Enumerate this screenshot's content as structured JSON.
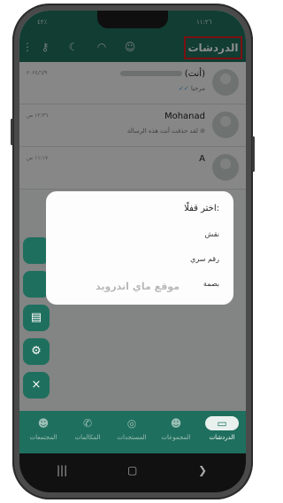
{
  "status_bar": {
    "time": "١١:٢٦",
    "left_status": "٤٢٪"
  },
  "app_bar": {
    "title": "الدردشات"
  },
  "chats": [
    {
      "name": "(أنت)",
      "preview": "مرحبا",
      "date": "٢٠٢٤/٦/٩"
    },
    {
      "name": "Mohanad",
      "preview": "لقد حذفت أنت هذه الرسالة",
      "date": "١٢:٣٦ ص"
    },
    {
      "name": "A",
      "preview": "",
      "date": "١١:١٧ ص"
    }
  ],
  "dialog": {
    "title": "اختر قفلًا:",
    "options": [
      "نقش",
      "رقم سري",
      "بصمة"
    ],
    "watermark": "موقع ماي اندرويد"
  },
  "bottom_nav": {
    "items": [
      {
        "label": "الدردشات",
        "icon": "chat-bubbles-icon"
      },
      {
        "label": "المجموعات",
        "icon": "groups-icon"
      },
      {
        "label": "المستجدات",
        "icon": "status-icon"
      },
      {
        "label": "المكالمات",
        "icon": "phone-icon"
      },
      {
        "label": "المجتمعات",
        "icon": "communities-icon"
      }
    ]
  },
  "colors": {
    "primary": "#1f6f5e",
    "highlight_border": "#e0201f"
  }
}
